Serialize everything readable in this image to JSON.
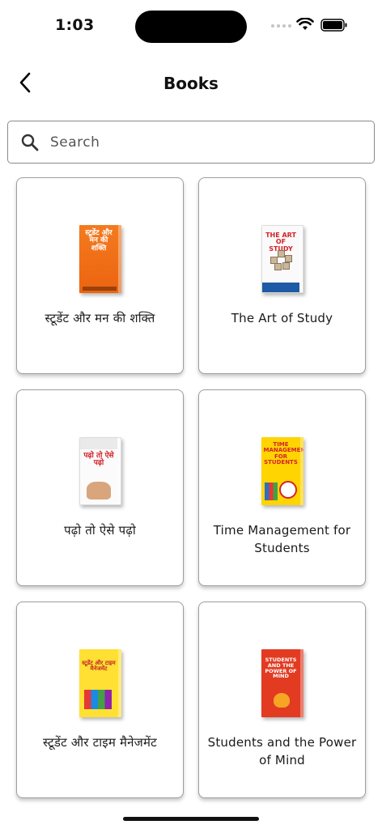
{
  "status_bar": {
    "time": "1:03"
  },
  "header": {
    "title": "Books",
    "back_icon": "chevron-left-icon"
  },
  "search": {
    "placeholder": "Search",
    "value": "",
    "icon": "search-icon"
  },
  "books": [
    {
      "title": "स्टूडेंट और मन की शक्ति",
      "cover_text": "स्टूडेंट और मन की शक्ति"
    },
    {
      "title": "The Art of Study",
      "cover_text": "THE ART OF STUDY"
    },
    {
      "title": "पढ़ो तो ऐसे पढ़ो",
      "cover_text": "पढ़ो तो ऐसे पढ़ो"
    },
    {
      "title": "Time Management for Students",
      "cover_text": "TIME MANAGEMENT FOR STUDENTS"
    },
    {
      "title": "स्टूडेंट और टाइम मैनेजमेंट",
      "cover_text": "स्टूडेंट और टाइम मैनेजमेंट"
    },
    {
      "title": "Students and the Power of Mind",
      "cover_text": "STUDENTS AND THE POWER OF MIND"
    }
  ]
}
